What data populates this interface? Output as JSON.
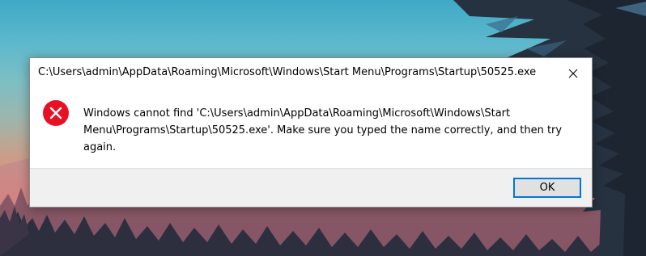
{
  "dialog": {
    "title": "C:\\Users\\admin\\AppData\\Roaming\\Microsoft\\Windows\\Start Menu\\Programs\\Startup\\50525.exe",
    "message": "Windows cannot find 'C:\\Users\\admin\\AppData\\Roaming\\Microsoft\\Windows\\Start Menu\\Programs\\Startup\\50525.exe'. Make sure you typed the name correctly, and then try again.",
    "ok_label": "OK",
    "icon": "error-icon",
    "close_icon": "close-icon"
  },
  "colors": {
    "error_red": "#e81123",
    "focus_blue": "#0078d7",
    "footer_bg": "#f0f0f0"
  }
}
